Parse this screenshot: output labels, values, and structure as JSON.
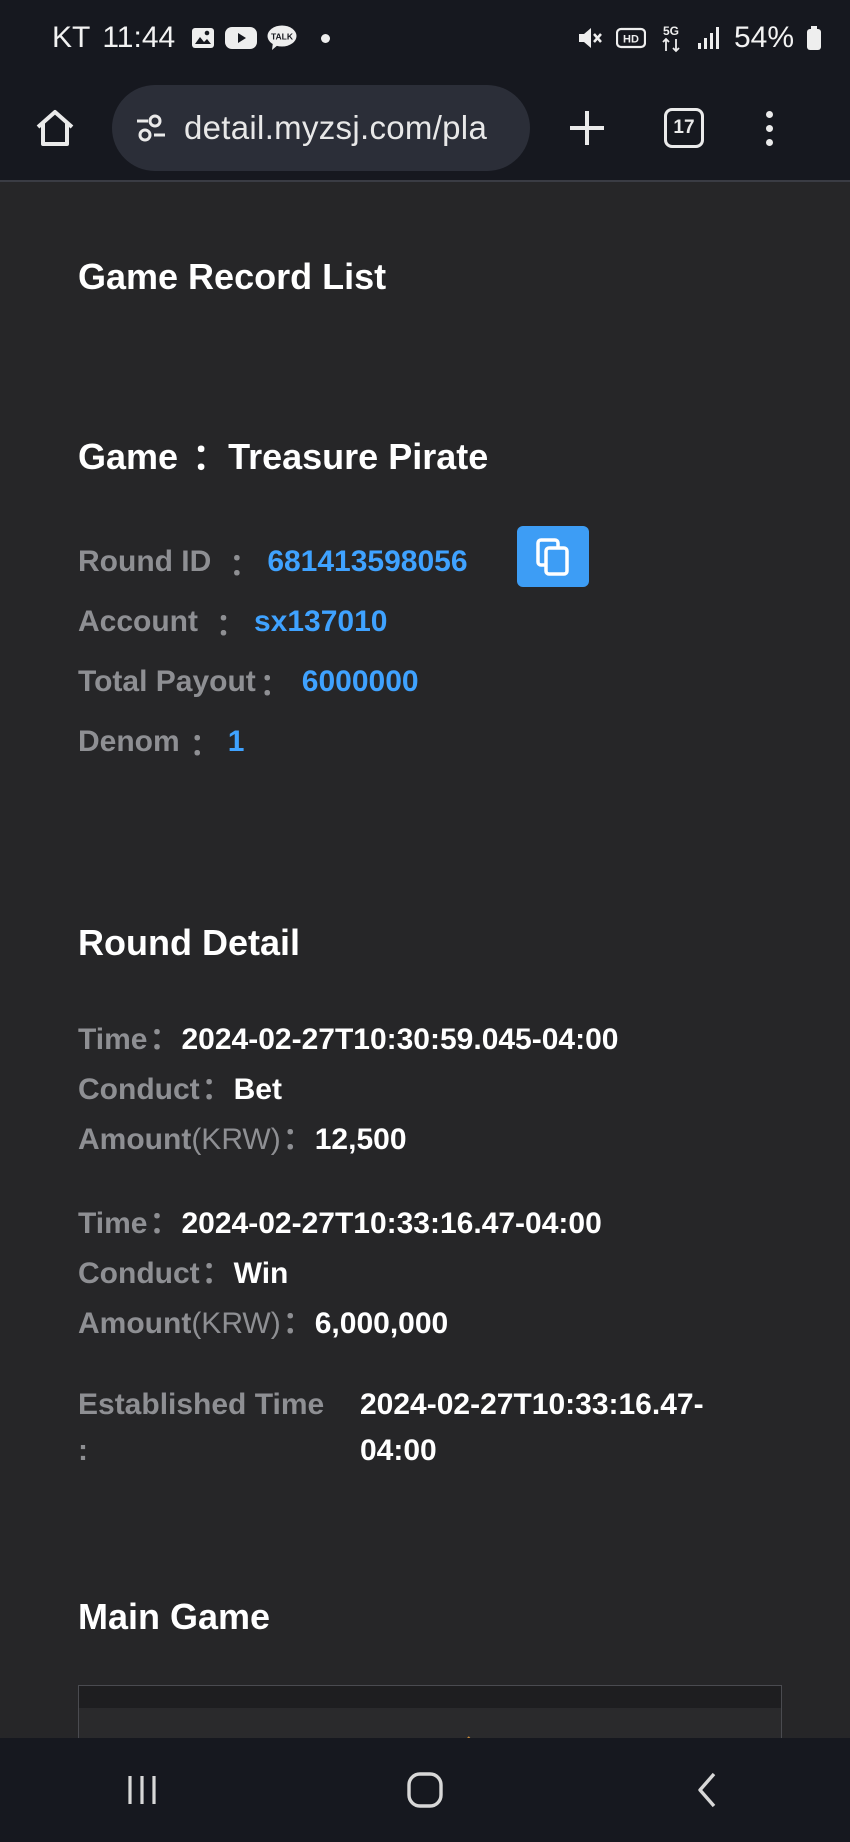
{
  "status_bar": {
    "carrier": "KT",
    "time": "11:44",
    "notification_icons": [
      "gallery-icon",
      "youtube-icon",
      "talk-icon"
    ],
    "talk_label": "TALK",
    "hd_label": "HD",
    "network_label": "5G",
    "battery": "54%"
  },
  "browser": {
    "url": "detail.myzsj.com/pla",
    "tab_count": "17"
  },
  "page": {
    "title": "Game Record List",
    "game": {
      "label": "Game",
      "separator": "：",
      "name": "Treasure Pirate"
    },
    "info": [
      {
        "label": "Round ID",
        "colon": "：",
        "value": "681413598056"
      },
      {
        "label": "Account",
        "colon": "：",
        "value": "sx137010"
      },
      {
        "label": "Total Payout",
        "colon": "：",
        "value": "6000000"
      },
      {
        "label": "Denom",
        "colon": "：",
        "value": "1"
      }
    ],
    "round_detail": {
      "heading": "Round Detail",
      "entries": [
        {
          "time_label": "Time",
          "time_value": "2024-02-27T10:30:59.045-04:00",
          "conduct_label": "Conduct",
          "conduct_value": "Bet",
          "amount_label": "Amount",
          "amount_unit": "(KRW)",
          "amount_value": "12,500"
        },
        {
          "time_label": "Time",
          "time_value": "2024-02-27T10:33:16.47-04:00",
          "conduct_label": "Conduct",
          "conduct_value": "Win",
          "amount_label": "Amount",
          "amount_unit": "(KRW)",
          "amount_value": "6,000,000"
        }
      ],
      "colon": "：",
      "established_label": "Established Time",
      "established_colon": ":",
      "established_value_line1": "2024-02-27T10:33:16.47-",
      "established_value_line2": "04:00"
    },
    "main_game": {
      "heading": "Main Game"
    }
  },
  "colors": {
    "background": "#262628",
    "chrome": "#16181f",
    "link_blue": "#3fa2ff",
    "label_gray": "#8e8f93",
    "copy_button": "#3d9df5"
  }
}
